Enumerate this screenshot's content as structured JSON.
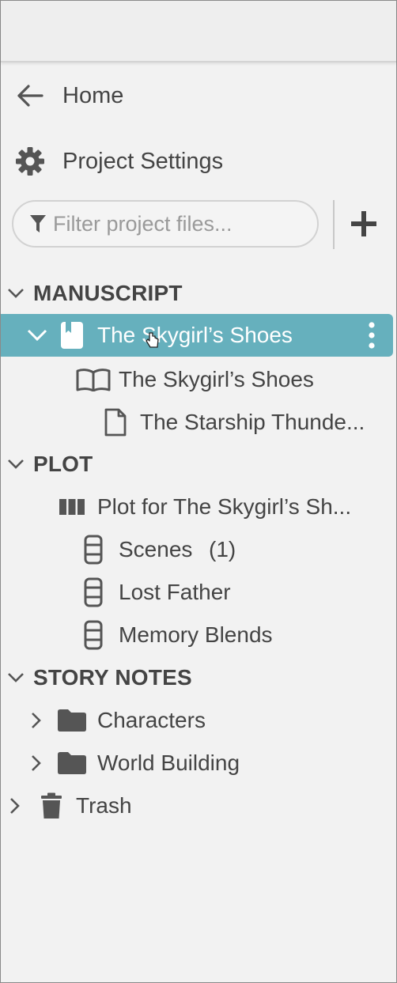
{
  "nav": {
    "home_label": "Home",
    "settings_label": "Project Settings"
  },
  "filter": {
    "placeholder": "Filter project files...",
    "value": ""
  },
  "sections": {
    "manuscript": "MANUSCRIPT",
    "plot": "PLOT",
    "story_notes": "STORY NOTES"
  },
  "manuscript": {
    "book_title": "The Skygirl’s Shoes",
    "part_title": "The Skygirl’s Shoes",
    "chapter_title": "The Starship Thunde..."
  },
  "plot": {
    "board_title": "Plot for The Skygirl’s Sh...",
    "items": [
      {
        "label": "Scenes",
        "count": "(1)"
      },
      {
        "label": "Lost Father"
      },
      {
        "label": "Memory Blends"
      }
    ]
  },
  "story_notes": {
    "folders": [
      "Characters",
      "World Building"
    ]
  },
  "trash_label": "Trash",
  "colors": {
    "selection": "#66b0bd",
    "text": "#444444",
    "background": "#f2f2f2"
  }
}
